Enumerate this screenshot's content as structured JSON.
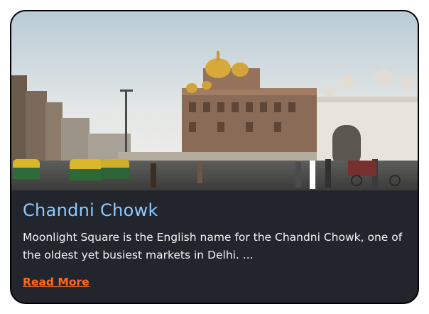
{
  "card": {
    "title": "Chandni Chowk",
    "description": "Moonlight Square is the English name for the Chandni Chowk, one of the oldest yet busiest markets in Delhi. ...",
    "read_more_label": "Read More"
  },
  "colors": {
    "card_background": "#22262c",
    "title": "#8ec9ff",
    "link": "#ff6a1a"
  }
}
